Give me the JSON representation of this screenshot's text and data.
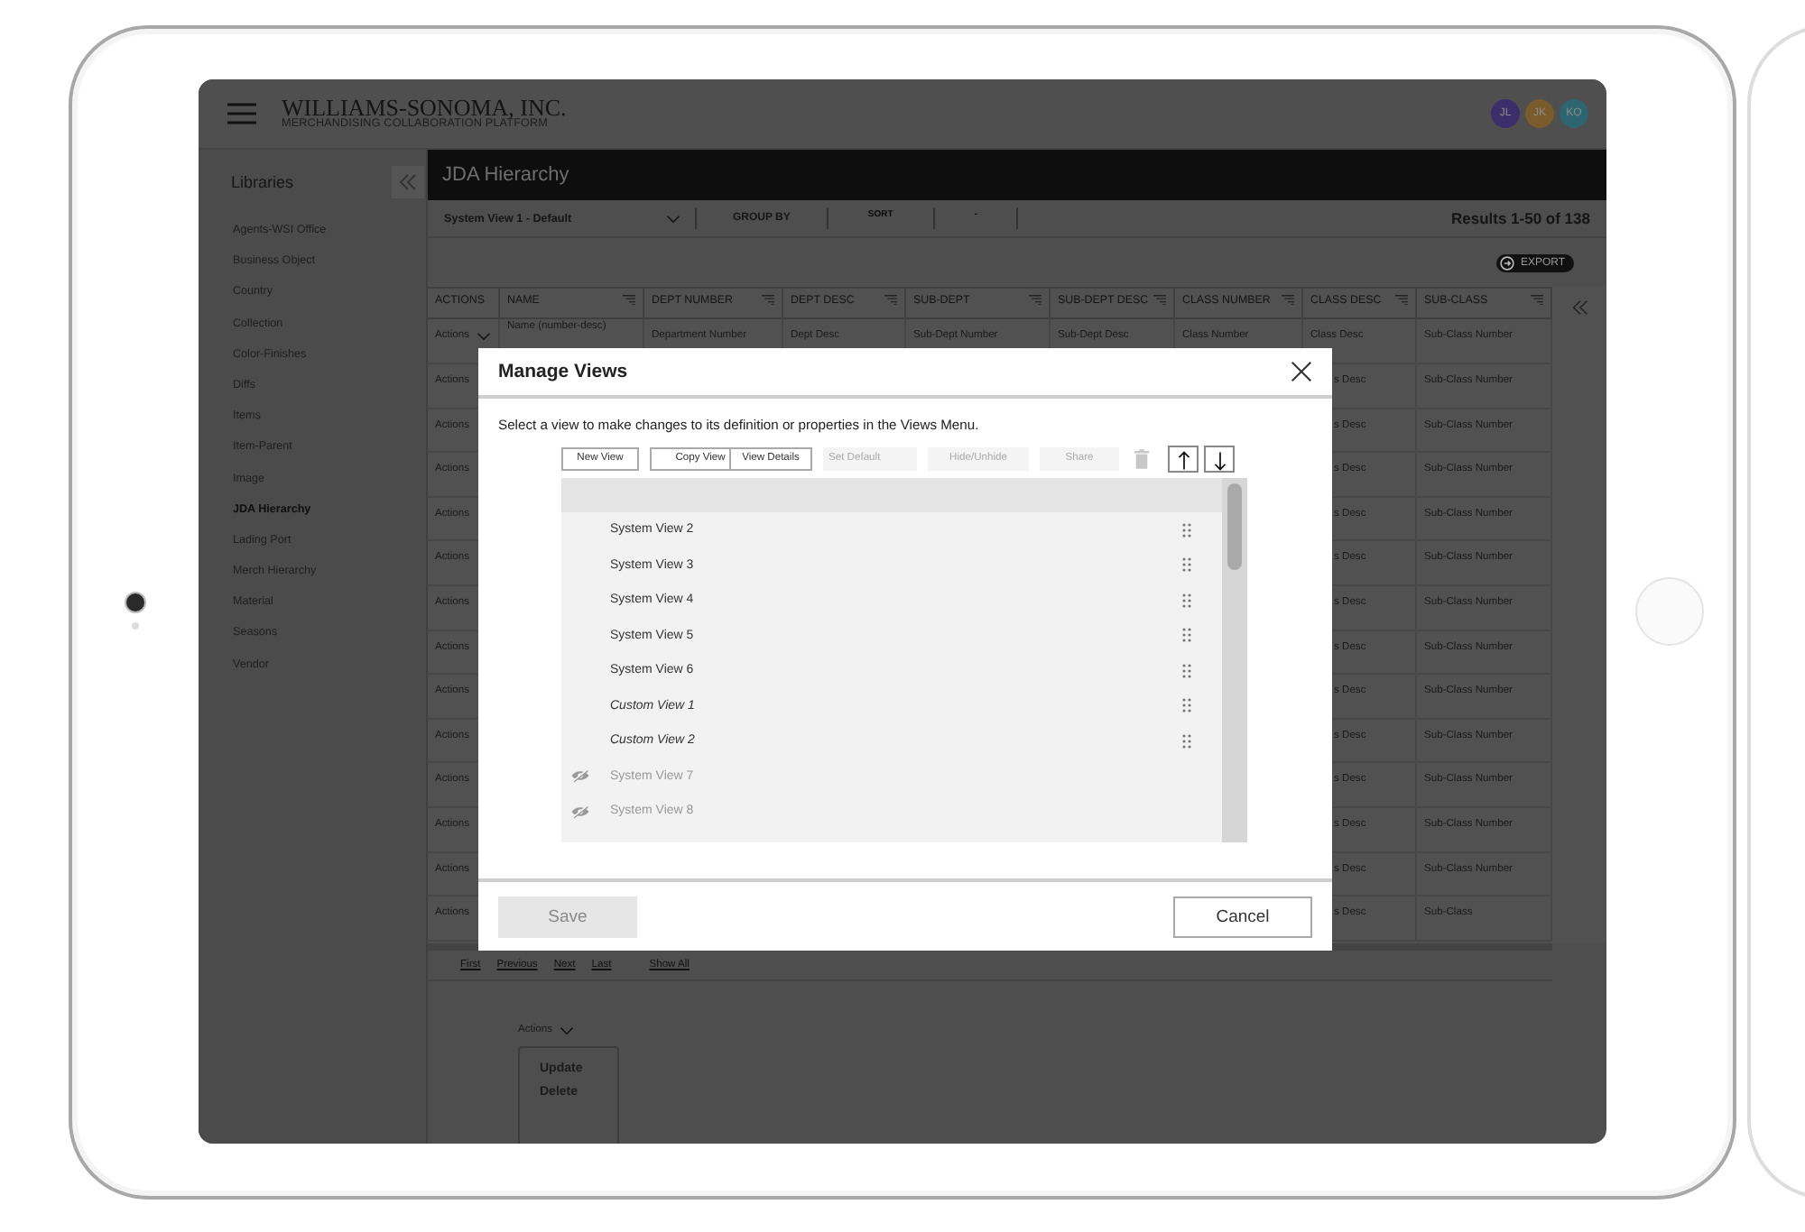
{
  "app": {
    "logo": "WILLIAMS-SONOMA, INC.",
    "subtitle": "MERCHANDISING COLLABORATION PLATFORM",
    "avatars": [
      {
        "initials": "JL",
        "color": "#3a2f6a"
      },
      {
        "initials": "JK",
        "color": "#7a5c2c"
      },
      {
        "initials": "KO",
        "color": "#2d6670"
      }
    ]
  },
  "sidebar": {
    "title": "Libraries",
    "items": [
      {
        "label": "Agents-WSI Office",
        "selected": false
      },
      {
        "label": "Business Object",
        "selected": false
      },
      {
        "label": "Country",
        "selected": false
      },
      {
        "label": "Collection",
        "selected": false
      },
      {
        "label": "Color-Finishes",
        "selected": false
      },
      {
        "label": "Diffs",
        "selected": false
      },
      {
        "label": "Items",
        "selected": false
      },
      {
        "label": "Item-Parent",
        "selected": false
      },
      {
        "label": "Image",
        "selected": false
      },
      {
        "label": "JDA Hierarchy",
        "selected": true
      },
      {
        "label": "Lading Port",
        "selected": false
      },
      {
        "label": "Merch Hierarchy",
        "selected": false
      },
      {
        "label": "Material",
        "selected": false
      },
      {
        "label": "Seasons",
        "selected": false
      },
      {
        "label": "Vendor",
        "selected": false
      }
    ]
  },
  "page": {
    "title": "JDA Hierarchy",
    "view": "System View 1 - Default",
    "group_by": "GROUP BY",
    "sort": "SORT",
    "sort_value": "-",
    "results": "Results 1-50 of 138",
    "export": "EXPORT"
  },
  "table": {
    "columns": [
      {
        "label": "ACTIONS",
        "filter": false
      },
      {
        "label": "NAME",
        "filter": true
      },
      {
        "label": "DEPT NUMBER",
        "filter": true
      },
      {
        "label": "DEPT DESC",
        "filter": true
      },
      {
        "label": "SUB-DEPT",
        "filter": true
      },
      {
        "label": "SUB-DEPT DESC",
        "filter": true
      },
      {
        "label": "CLASS NUMBER",
        "filter": true
      },
      {
        "label": "CLASS DESC",
        "filter": true
      },
      {
        "label": "SUB-CLASS",
        "filter": true
      }
    ],
    "first_row": {
      "actions": "Actions",
      "cells": [
        "Name (number-desc)",
        "Department Number",
        "Dept Desc",
        "Sub-Dept Number",
        "Sub-Dept Desc",
        "Class Number",
        "Class Desc",
        "Sub-Class Number"
      ]
    },
    "rows": [
      {
        "actions": "Actions",
        "class_desc": "s Desc",
        "sub_class": "Sub-Class Number"
      },
      {
        "actions": "Actions",
        "class_desc": "s Desc",
        "sub_class": "Sub-Class Number"
      },
      {
        "actions": "Actions",
        "class_desc": "s Desc",
        "sub_class": "Sub-Class Number"
      },
      {
        "actions": "Actions",
        "class_desc": "s Desc",
        "sub_class": "Sub-Class Number"
      },
      {
        "actions": "Actions",
        "class_desc": "s Desc",
        "sub_class": "Sub-Class Number"
      },
      {
        "actions": "Actions",
        "class_desc": "s Desc",
        "sub_class": "Sub-Class Number"
      },
      {
        "actions": "Actions",
        "class_desc": "s Desc",
        "sub_class": "Sub-Class Number"
      },
      {
        "actions": "Actions",
        "class_desc": "s Desc",
        "sub_class": "Sub-Class Number"
      },
      {
        "actions": "Actions",
        "class_desc": "s Desc",
        "sub_class": "Sub-Class Number"
      },
      {
        "actions": "Actions",
        "class_desc": "s Desc",
        "sub_class": "Sub-Class Number"
      },
      {
        "actions": "Actions",
        "class_desc": "s Desc",
        "sub_class": "Sub-Class Number"
      },
      {
        "actions": "Actions",
        "class_desc": "s Desc",
        "sub_class": "Sub-Class Number"
      },
      {
        "actions": "Actions",
        "class_desc": "s Desc",
        "sub_class": "Sub-Class"
      }
    ]
  },
  "pagination": [
    "First",
    "Previous",
    "Next",
    "Last",
    "Show All"
  ],
  "actions_menu": {
    "label": "Actions",
    "items": [
      "Update",
      "Delete"
    ]
  },
  "dialog": {
    "title": "Manage Views",
    "description": "Select a view to make changes to its definition or properties in the Views Menu.",
    "tools": [
      {
        "label": "New View",
        "disabled": false
      },
      {
        "label": "Copy View",
        "disabled": false
      },
      {
        "label": "View Details",
        "disabled": false
      },
      {
        "label": "Set Default",
        "disabled": true
      },
      {
        "label": "Hide/Unhide",
        "disabled": true
      },
      {
        "label": "Share",
        "disabled": true
      }
    ],
    "views": [
      {
        "name": "System View 2",
        "kind": "system",
        "hidden": false
      },
      {
        "name": "System View 3",
        "kind": "system",
        "hidden": false
      },
      {
        "name": "System View 4",
        "kind": "system",
        "hidden": false
      },
      {
        "name": "System View 5",
        "kind": "system",
        "hidden": false
      },
      {
        "name": "System View 6",
        "kind": "system",
        "hidden": false
      },
      {
        "name": "Custom View 1",
        "kind": "custom",
        "hidden": false
      },
      {
        "name": "Custom View 2",
        "kind": "custom",
        "hidden": false
      },
      {
        "name": "System View 7",
        "kind": "system",
        "hidden": true
      },
      {
        "name": "System View 8",
        "kind": "system",
        "hidden": true
      }
    ],
    "save": {
      "label": "Save",
      "disabled": true
    },
    "cancel": "Cancel"
  }
}
